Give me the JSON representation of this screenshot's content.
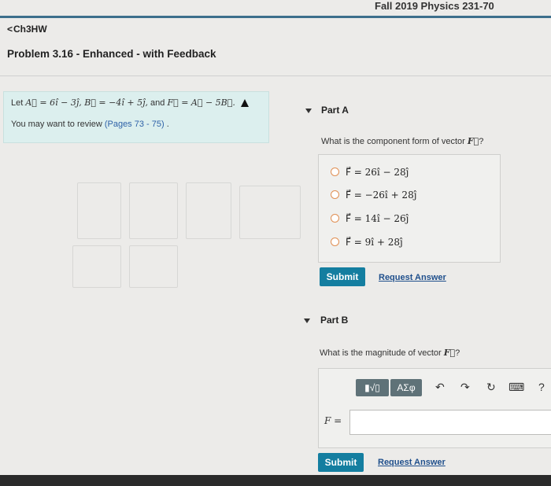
{
  "header": {
    "course_title": "Fall 2019 Physics 231-70",
    "back_link": "Ch3HW",
    "problem_title": "Problem 3.16 - Enhanced - with Feedback"
  },
  "intro": {
    "lead": "Let ",
    "definitions": "A⃗ = 6î − 3ĵ, B⃗ = −4î + 5ĵ,",
    "and_word": " and ",
    "f_def": "F⃗ = A⃗ − 5B⃗.",
    "review_text": "You may want to review ",
    "review_pages": "(Pages 73 - 75)",
    "review_end": " ."
  },
  "part_a": {
    "label": "Part A",
    "question_pre": "What is the component form of vector ",
    "question_vec": "F⃗",
    "question_post": "?",
    "choices": [
      "F⃗ = 26î − 28ĵ",
      "F⃗ = −26î + 28ĵ",
      "F⃗ = 14î − 26ĵ",
      "F⃗ = 9î + 28ĵ"
    ],
    "submit_label": "Submit",
    "request_label": "Request Answer"
  },
  "part_b": {
    "label": "Part B",
    "question_pre": "What is the magnitude of vector ",
    "question_vec": "F⃗",
    "question_post": "?",
    "toolbar": {
      "templates": "▮√▯",
      "symbols": "ΑΣφ",
      "undo": "↶",
      "redo": "↷",
      "reset": "↻",
      "keyboard": "⌨",
      "help": "?"
    },
    "input_label": "F =",
    "input_value": "",
    "submit_label": "Submit",
    "request_label": "Request Answer"
  }
}
